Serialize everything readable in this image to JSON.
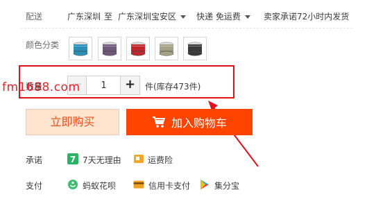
{
  "delivery": {
    "label": "配送",
    "from": "广东深圳",
    "to_word": "至",
    "to": "广东深圳宝安区",
    "shipping": "快递 免运费",
    "promise": "卖家承诺72小时内发货"
  },
  "color": {
    "label": "颜色分类",
    "swatches": [
      {
        "name": "blue",
        "hex": "#2b8fb8"
      },
      {
        "name": "purple",
        "hex": "#6e5a78"
      },
      {
        "name": "red",
        "hex": "#c0272d"
      },
      {
        "name": "champagne",
        "hex": "#a5a287"
      },
      {
        "name": "black",
        "hex": "#3a3a3a"
      }
    ]
  },
  "quantity": {
    "label": "数量",
    "minus": "−",
    "value": "1",
    "plus": "+",
    "stock": "件(库存473件)"
  },
  "watermark": "fm1688.com",
  "actions": {
    "buy_now": "立即购买",
    "add_cart": "加入购物车"
  },
  "promise": {
    "label": "承诺",
    "items": [
      "7天无理由",
      "运费险"
    ]
  },
  "payment": {
    "label": "支付",
    "items": [
      "蚂蚁花呗",
      "信用卡支付",
      "集分宝"
    ]
  },
  "colors": {
    "accent": "#ff4400",
    "annotation": "#e1101a"
  }
}
